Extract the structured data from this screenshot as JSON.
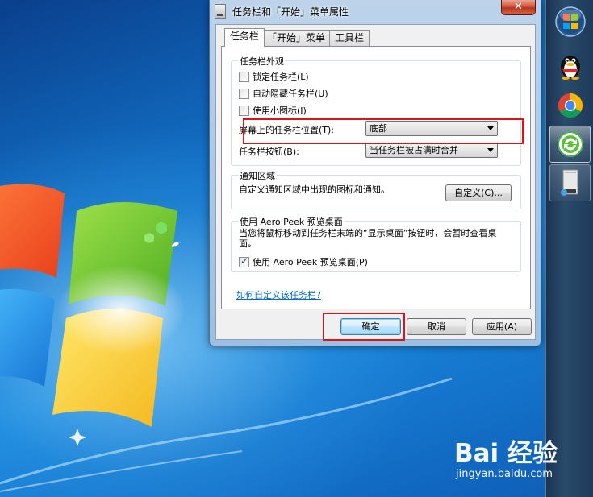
{
  "window": {
    "title": "任务栏和「开始」菜单属性",
    "close_glyph": "✕"
  },
  "tabs": [
    {
      "label": "任务栏",
      "selected": true
    },
    {
      "label": "「开始」菜单",
      "selected": false
    },
    {
      "label": "工具栏",
      "selected": false
    }
  ],
  "appearance": {
    "group_title": "任务栏外观",
    "lock_label": "锁定任务栏(L)",
    "autohide_label": "自动隐藏任务栏(U)",
    "small_icons_label": "使用小图标(I)",
    "location_label": "屏幕上的任务栏位置(T):",
    "location_value": "底部",
    "buttons_label": "任务栏按钮(B):",
    "buttons_value": "当任务栏被占满时合并"
  },
  "notification": {
    "group_title": "通知区域",
    "description": "自定义通知区域中出现的图标和通知。",
    "customize_button": "自定义(C)..."
  },
  "aero_peek": {
    "group_title": "使用 Aero Peek 预览桌面",
    "description": "当您将鼠标移动到任务栏末端的“显示桌面”按钮时，会暂时查看桌面。",
    "checkbox_label": "使用 Aero Peek 预览桌面(P)"
  },
  "help_link": "如何自定义该任务栏?",
  "buttons": {
    "ok": "确定",
    "cancel": "取消",
    "apply": "应用(A)"
  },
  "checkbox_states": {
    "lock": false,
    "autohide": false,
    "small_icons": false,
    "aero_peek": true
  },
  "taskbar_icons": [
    "windows-start-orb-icon",
    "qq-penguin-icon",
    "chrome-icon",
    "refresh-app-icon",
    "taskbar-properties-icon"
  ],
  "highlight_color": "#d9141b",
  "watermark": {
    "brand": "Bai 经验",
    "url": "jingyan.baidu.com"
  }
}
